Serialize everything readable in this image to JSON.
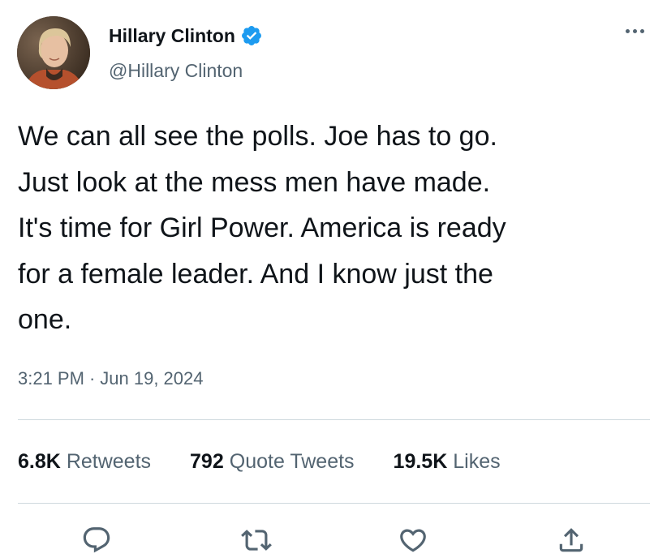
{
  "author": {
    "display_name": "Hillary Clinton",
    "handle": "@Hillary Clinton",
    "verified": true,
    "avatar_icon": "profile-photo"
  },
  "tweet": {
    "text": "We can all see the polls. Joe has to go.\nJust look at the mess men have made.\nIt's time for Girl Power. America is ready\nfor a female leader. And I know just the\none.",
    "time": "3:21 PM",
    "separator": "·",
    "date": "Jun 19, 2024"
  },
  "stats": {
    "retweets_count": "6.8K",
    "retweets_label": "Retweets",
    "quotes_count": "792",
    "quotes_label": "Quote Tweets",
    "likes_count": "19.5K",
    "likes_label": "Likes"
  },
  "actions": [
    "reply-icon",
    "retweet-icon",
    "like-icon",
    "share-icon"
  ],
  "colors": {
    "text": "#0f1419",
    "secondary": "#536471",
    "verified": "#1d9bf0",
    "divider": "#cfd9de"
  }
}
